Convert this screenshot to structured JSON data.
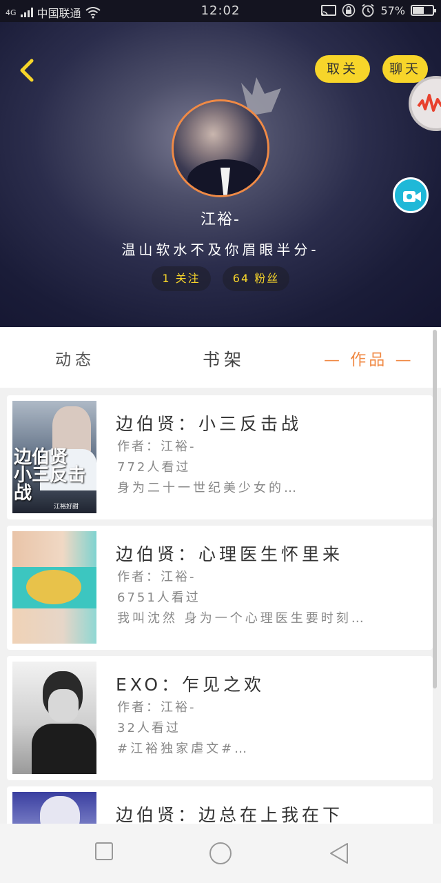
{
  "status_bar": {
    "network": "4G",
    "carrier": "中国联通",
    "time": "12:02",
    "battery": "57%",
    "battery_level": 0.57,
    "icons": [
      "signal-icon",
      "wifi-icon",
      "cast-icon",
      "lock-icon",
      "alarm-icon",
      "battery-icon"
    ]
  },
  "profile": {
    "back_icon": "chevron-left-icon",
    "unfollow_label": "取关",
    "chat_label": "聊天",
    "nickname": "江裕-",
    "bio": "温山软水不及你眉眼半分-",
    "follows": "1 关注",
    "fans": "64 粉丝",
    "accent": "#f7d52a"
  },
  "tabs": {
    "items": [
      "动态",
      "书架",
      "— 作品 —"
    ],
    "active_index": 2,
    "active_color": "#f08a45"
  },
  "works": [
    {
      "title": "边伯贤：小三反击战",
      "author": "作者：江裕-",
      "views": "772人看过",
      "desc": "身为二十一世纪美少女的…",
      "cover_text_1": "边伯贤",
      "cover_text_2": "小三反击战",
      "cover_sub": "江裕好甜"
    },
    {
      "title": "边伯贤：心理医生怀里来",
      "author": "作者：江裕-",
      "views": "6751人看过",
      "desc": "我叫沈然 身为一个心理医生要时刻…"
    },
    {
      "title": "EXO：乍见之欢",
      "author": "作者：江裕-",
      "views": "32人看过",
      "desc": "#江裕独家虐文#…"
    },
    {
      "title": "边伯贤：边总在上我在下",
      "author": "",
      "views": "",
      "desc": ""
    }
  ],
  "nav": {
    "icons": [
      "recent-apps-icon",
      "home-icon",
      "back-icon"
    ]
  }
}
